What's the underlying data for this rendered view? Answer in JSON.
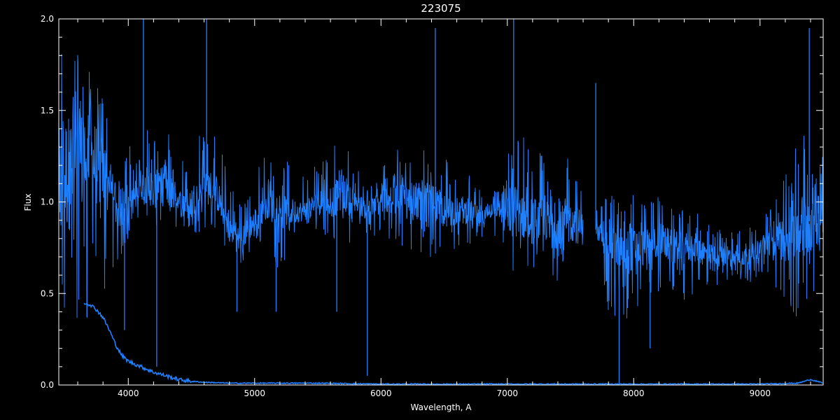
{
  "chart_data": {
    "type": "line",
    "title": "223075",
    "xlabel": "Wavelength, A",
    "ylabel": "Flux",
    "xlim": [
      3450,
      9500
    ],
    "ylim": [
      0,
      2.0
    ],
    "x_ticks": [
      4000,
      5000,
      6000,
      7000,
      8000,
      9000
    ],
    "x_tick_labels": [
      "4000",
      "5000",
      "6000",
      "7000",
      "8000",
      "9000"
    ],
    "y_ticks": [
      0,
      0.5,
      1.0,
      1.5,
      2.0
    ],
    "y_tick_labels": [
      "0.0",
      "0.5",
      "1.0",
      "1.5",
      "2.0"
    ],
    "grid": false,
    "colors": {
      "background": "#000000",
      "axes": "#ffffff",
      "series": "#1e7fff"
    },
    "series": [
      {
        "role": "spectrum_envelope",
        "gap": [
          7600,
          7700
        ],
        "x": [
          3450,
          3500,
          3600,
          3700,
          3800,
          3900,
          4000,
          4100,
          4200,
          4300,
          4400,
          4500,
          4600,
          4700,
          4800,
          4900,
          5000,
          5100,
          5200,
          5300,
          5400,
          5500,
          5600,
          5700,
          5800,
          5900,
          6000,
          6100,
          6200,
          6300,
          6400,
          6500,
          6600,
          6700,
          6800,
          6900,
          7000,
          7100,
          7200,
          7300,
          7400,
          7500,
          7600,
          7700,
          7800,
          7900,
          8000,
          8100,
          8200,
          8300,
          8400,
          8500,
          8600,
          8700,
          8800,
          8900,
          9000,
          9100,
          9200,
          9300,
          9400,
          9500
        ],
        "low": [
          0.0,
          0.1,
          0.1,
          0.3,
          0.45,
          0.6,
          0.8,
          0.95,
          0.85,
          0.8,
          0.85,
          0.8,
          0.85,
          0.85,
          0.7,
          0.65,
          0.75,
          0.8,
          0.6,
          0.8,
          0.85,
          0.85,
          0.8,
          0.7,
          0.85,
          0.8,
          0.8,
          0.75,
          0.7,
          0.7,
          0.7,
          0.7,
          0.75,
          0.75,
          0.75,
          0.8,
          0.6,
          0.55,
          0.55,
          0.6,
          0.55,
          0.55,
          0.6,
          0.75,
          0.4,
          0.25,
          0.35,
          0.45,
          0.5,
          0.45,
          0.45,
          0.5,
          0.5,
          0.55,
          0.55,
          0.55,
          0.6,
          0.55,
          0.4,
          0.3,
          0.45,
          0.55
        ],
        "high": [
          2.0,
          2.0,
          1.9,
          1.7,
          1.6,
          1.45,
          1.3,
          1.45,
          1.35,
          1.5,
          1.25,
          1.3,
          1.45,
          1.4,
          1.1,
          1.0,
          1.15,
          1.3,
          1.25,
          1.2,
          1.15,
          1.25,
          1.3,
          1.35,
          1.2,
          1.1,
          1.2,
          1.3,
          1.35,
          1.3,
          1.3,
          1.25,
          1.2,
          1.15,
          1.05,
          1.2,
          1.35,
          1.4,
          1.3,
          1.25,
          1.2,
          1.25,
          1.1,
          1.0,
          1.05,
          1.0,
          1.05,
          1.0,
          1.05,
          1.0,
          0.95,
          0.95,
          0.9,
          0.85,
          0.85,
          0.85,
          0.9,
          1.05,
          1.15,
          1.35,
          1.5,
          1.4
        ],
        "mid": [
          1.05,
          1.15,
          1.2,
          1.25,
          1.15,
          1.0,
          0.95,
          1.1,
          1.05,
          1.1,
          1.0,
          1.0,
          1.1,
          1.05,
          0.85,
          0.8,
          0.9,
          1.0,
          0.95,
          0.95,
          0.95,
          1.0,
          1.0,
          1.05,
          1.0,
          0.95,
          1.0,
          1.05,
          1.05,
          1.0,
          1.0,
          0.95,
          0.95,
          0.95,
          0.9,
          1.0,
          0.95,
          0.95,
          0.9,
          0.9,
          0.85,
          0.9,
          0.85,
          0.85,
          0.8,
          0.7,
          0.75,
          0.75,
          0.8,
          0.75,
          0.75,
          0.75,
          0.7,
          0.7,
          0.7,
          0.7,
          0.75,
          0.8,
          0.8,
          0.85,
          0.9,
          0.95
        ],
        "deep_absorptions": [
          {
            "x": 3970,
            "y": 0.3
          },
          {
            "x": 4225,
            "y": 0.1
          },
          {
            "x": 4860,
            "y": 0.4
          },
          {
            "x": 5170,
            "y": 0.4
          },
          {
            "x": 5650,
            "y": 0.4
          },
          {
            "x": 5892,
            "y": 0.05
          },
          {
            "x": 7885,
            "y": 0.0
          },
          {
            "x": 8130,
            "y": 0.2
          }
        ],
        "sharp_emissions": [
          {
            "x": 4120,
            "y": 2.0
          },
          {
            "x": 4620,
            "y": 2.0
          },
          {
            "x": 7050,
            "y": 2.0
          },
          {
            "x": 6430,
            "y": 1.95
          },
          {
            "x": 7700,
            "y": 1.65
          },
          {
            "x": 9390,
            "y": 1.95
          }
        ]
      },
      {
        "role": "lower_curve",
        "x": [
          3650,
          3700,
          3750,
          3800,
          3850,
          3900,
          3950,
          4000,
          4100,
          4200,
          4300,
          4400,
          4500,
          4600,
          4800,
          5000,
          5500,
          6000,
          7000,
          8000,
          9000,
          9300,
          9350,
          9400,
          9450,
          9500
        ],
        "y": [
          0.45,
          0.44,
          0.41,
          0.37,
          0.3,
          0.22,
          0.16,
          0.13,
          0.1,
          0.07,
          0.05,
          0.03,
          0.02,
          0.015,
          0.01,
          0.01,
          0.01,
          0.005,
          0.005,
          0.005,
          0.005,
          0.01,
          0.02,
          0.03,
          0.02,
          0.01
        ]
      }
    ]
  }
}
